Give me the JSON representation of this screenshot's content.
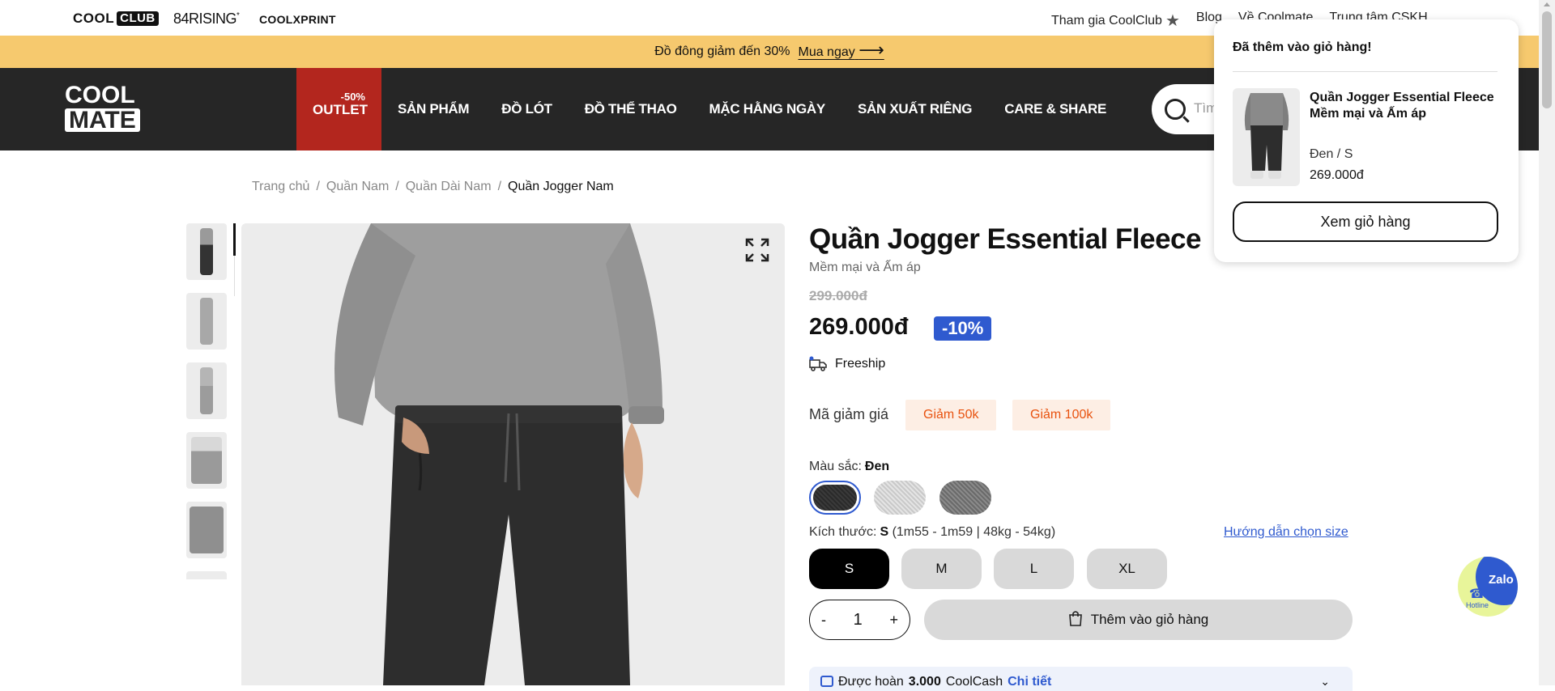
{
  "topbar": {
    "brands": {
      "coolclub_a": "COOL",
      "coolclub_b": "CLUB",
      "rising": "84RISING",
      "rising_mark": "*",
      "coolxprint": "COOLXPRINT"
    },
    "links": [
      "Tham gia CoolClub",
      "Blog",
      "Về Coolmate",
      "Trung tâm CSKH"
    ]
  },
  "promo": {
    "text": "Đồ đông giảm đến 30%",
    "cta": "Mua ngay"
  },
  "nav": {
    "logo_top": "COOL",
    "logo_bottom": "MATE",
    "outlet_pct": "-50%",
    "outlet_label": "OUTLET",
    "items": [
      "SẢN PHẨM",
      "ĐỒ LÓT",
      "ĐỒ THỂ THAO",
      "MẶC HẰNG NGÀY",
      "SẢN XUẤT RIÊNG",
      "CARE & SHARE"
    ],
    "search_placeholder": "Tìm"
  },
  "breadcrumb": [
    "Trang chủ",
    "Quần Nam",
    "Quần Dài Nam",
    "Quần Jogger Nam"
  ],
  "product": {
    "title": "Quần Jogger Essential Fleece",
    "subtitle": "Mềm mại và Ấm áp",
    "old_price": "299.000đ",
    "price": "269.000đ",
    "discount": "-10%",
    "freeship": "Freeship",
    "coupon_label": "Mã giảm giá",
    "coupons": [
      "Giảm 50k",
      "Giảm 100k"
    ],
    "color_label": "Màu sắc:",
    "color_value": "Đen",
    "size_label": "Kích thước:",
    "size_value": "S",
    "size_detail": "(1m55 - 1m59 | 48kg - 54kg)",
    "size_guide": "Hướng dẫn chọn size",
    "sizes": [
      "S",
      "M",
      "L",
      "XL"
    ],
    "qty_minus": "-",
    "qty_value": "1",
    "qty_plus": "+",
    "add_to_cart": "Thêm vào giỏ hàng",
    "cashback_prefix": "Được hoàn",
    "cashback_amount": "3.000",
    "cashback_unit": "CoolCash",
    "cashback_link": "Chi tiết"
  },
  "popup": {
    "title": "Đã thêm vào giỏ hàng!",
    "item_name": "Quần Jogger Essential Fleece Mềm mại và Ấm áp",
    "item_variant": "Đen / S",
    "item_price": "269.000đ",
    "view_cart": "Xem giỏ hàng"
  },
  "zalo": {
    "label": "Zalo",
    "hotline": "Hotline"
  },
  "colors": {
    "accent_blue": "#2f5acf",
    "promo_bg": "#f6c96e",
    "nav_bg": "#262626",
    "outlet_red": "#b3261e",
    "coupon_text": "#e8520f"
  }
}
